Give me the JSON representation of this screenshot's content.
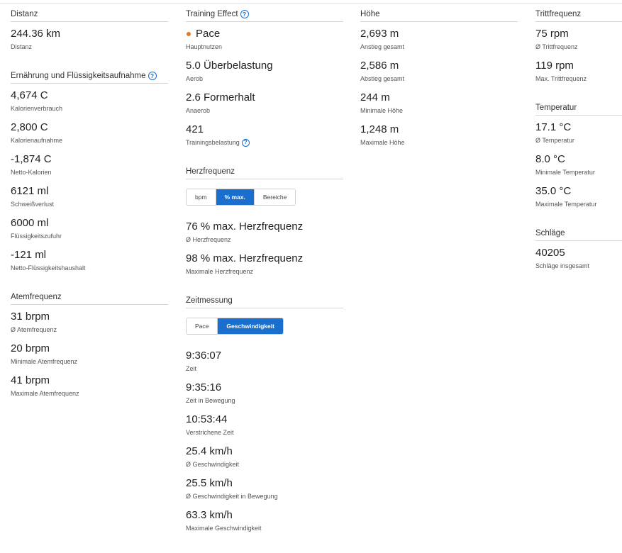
{
  "colors": {
    "accent": "#1a6fce",
    "pace_dot": "#e07a2a"
  },
  "distance": {
    "title": "Distanz",
    "items": [
      {
        "value": "244.36 km",
        "label": "Distanz"
      }
    ]
  },
  "nutrition": {
    "title": "Ernährung und Flüssigkeitsaufnahme",
    "items": [
      {
        "value": "4,674 C",
        "label": "Kalorienverbrauch"
      },
      {
        "value": "2,800 C",
        "label": "Kalorienaufnahme"
      },
      {
        "value": "-1,874 C",
        "label": "Netto-Kalorien"
      },
      {
        "value": "6121 ml",
        "label": "Schweißverlust"
      },
      {
        "value": "6000 ml",
        "label": "Flüssigkeitszufuhr"
      },
      {
        "value": "-121 ml",
        "label": "Netto-Flüssigkeitshaushalt"
      }
    ]
  },
  "respiration": {
    "title": "Atemfrequenz",
    "items": [
      {
        "value": "31 brpm",
        "label": "Ø Atemfrequenz"
      },
      {
        "value": "20 brpm",
        "label": "Minimale Atemfrequenz"
      },
      {
        "value": "41 brpm",
        "label": "Maximale Atemfrequenz"
      }
    ]
  },
  "training_effect": {
    "title": "Training Effect",
    "items": [
      {
        "value": "Pace",
        "label": "Hauptnutzen"
      },
      {
        "value": "5.0 Überbelastung",
        "label": "Aerob"
      },
      {
        "value": "2.6 Formerhalt",
        "label": "Anaerob"
      },
      {
        "value": "421",
        "label": "Trainingsbelastung"
      }
    ]
  },
  "heart_rate": {
    "title": "Herzfrequenz",
    "toggle": [
      "bpm",
      "% max.",
      "Bereiche"
    ],
    "active": "% max.",
    "items": [
      {
        "value": "76 % max. Herzfrequenz",
        "label": "Ø Herzfrequenz"
      },
      {
        "value": "98 % max. Herzfrequenz",
        "label": "Maximale Herzfrequenz"
      }
    ]
  },
  "timing": {
    "title": "Zeitmessung",
    "toggle": [
      "Pace",
      "Geschwindigkeit"
    ],
    "active": "Geschwindigkeit",
    "items": [
      {
        "value": "9:36:07",
        "label": "Zeit"
      },
      {
        "value": "9:35:16",
        "label": "Zeit in Bewegung"
      },
      {
        "value": "10:53:44",
        "label": "Verstrichene Zeit"
      },
      {
        "value": "25.4 km/h",
        "label": "Ø Geschwindigkeit"
      },
      {
        "value": "25.5 km/h",
        "label": "Ø Geschwindigkeit in Bewegung"
      },
      {
        "value": "63.3 km/h",
        "label": "Maximale Geschwindigkeit"
      }
    ]
  },
  "elevation": {
    "title": "Höhe",
    "items": [
      {
        "value": "2,693 m",
        "label": "Anstieg gesamt"
      },
      {
        "value": "2,586 m",
        "label": "Abstieg gesamt"
      },
      {
        "value": "244 m",
        "label": "Minimale Höhe"
      },
      {
        "value": "1,248 m",
        "label": "Maximale Höhe"
      }
    ]
  },
  "cadence": {
    "title": "Trittfrequenz",
    "items": [
      {
        "value": "75 rpm",
        "label": "Ø Trittfrequenz"
      },
      {
        "value": "119 rpm",
        "label": "Max. Trittfrequenz"
      }
    ]
  },
  "temperature": {
    "title": "Temperatur",
    "items": [
      {
        "value": "17.1 °C",
        "label": "Ø Temperatur"
      },
      {
        "value": "8.0 °C",
        "label": "Minimale Temperatur"
      },
      {
        "value": "35.0 °C",
        "label": "Maximale Temperatur"
      }
    ]
  },
  "strokes": {
    "title": "Schläge",
    "items": [
      {
        "value": "40205",
        "label": "Schläge insgesamt"
      }
    ]
  }
}
